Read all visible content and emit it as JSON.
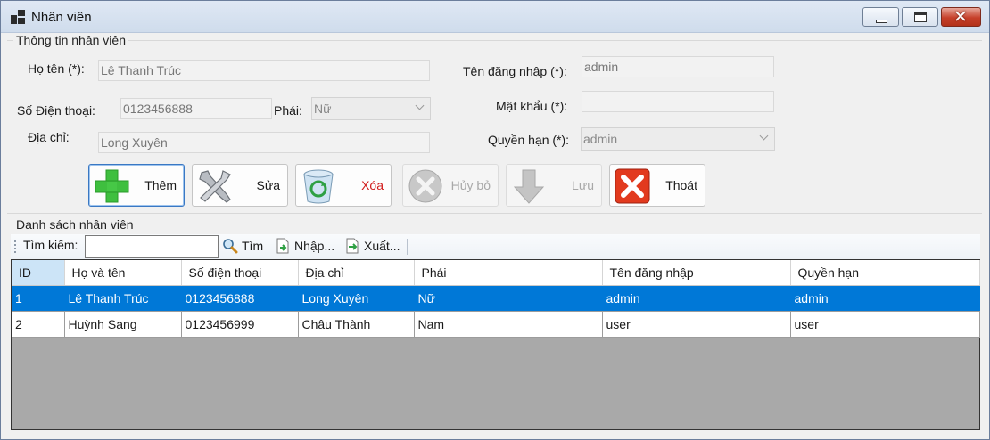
{
  "window": {
    "title": "Nhân viên",
    "controls": [
      "minimize",
      "maximize",
      "close"
    ],
    "close_color": "#c6402a"
  },
  "info_group": {
    "title": "Thông tin nhân viên",
    "fullname_label": "Họ tên (*):",
    "fullname_value": "Lê Thanh Trúc",
    "phone_label": "Số Điện thoại:",
    "phone_value": "0123456888",
    "gender_label": "Phái:",
    "gender_value": "Nữ",
    "address_label": "Địa chỉ:",
    "address_value": "Long Xuyên",
    "username_label": "Tên đăng nhập (*):",
    "username_value": "admin",
    "password_label": "Mật khẩu (*):",
    "password_value": "",
    "role_label": "Quyền hạn (*):",
    "role_value": "admin"
  },
  "actions": {
    "add": "Thêm",
    "edit": "Sửa",
    "delete": "Xóa",
    "cancel": "Hủy bỏ",
    "save": "Lưu",
    "exit": "Thoát",
    "delete_color": "#d11a1a"
  },
  "list_group": {
    "title": "Danh sách nhân viên"
  },
  "toolbar": {
    "search_label": "Tìm kiếm:",
    "search_value": "",
    "find": "Tìm",
    "import": "Nhập...",
    "export": "Xuất..."
  },
  "grid": {
    "columns": [
      "ID",
      "Họ và tên",
      "Số điện thoại",
      "Địa chỉ",
      "Phái",
      "Tên đăng nhập",
      "Quyền hạn"
    ],
    "rows": [
      [
        "1",
        "Lê Thanh Trúc",
        "0123456888",
        "Long Xuyên",
        "Nữ",
        "admin",
        "admin"
      ],
      [
        "2",
        "Huỳnh Sang",
        "0123456999",
        "Châu Thành",
        "Nam",
        "user",
        "user"
      ]
    ],
    "selected_row": 0,
    "selection_color": "#0078d7"
  }
}
